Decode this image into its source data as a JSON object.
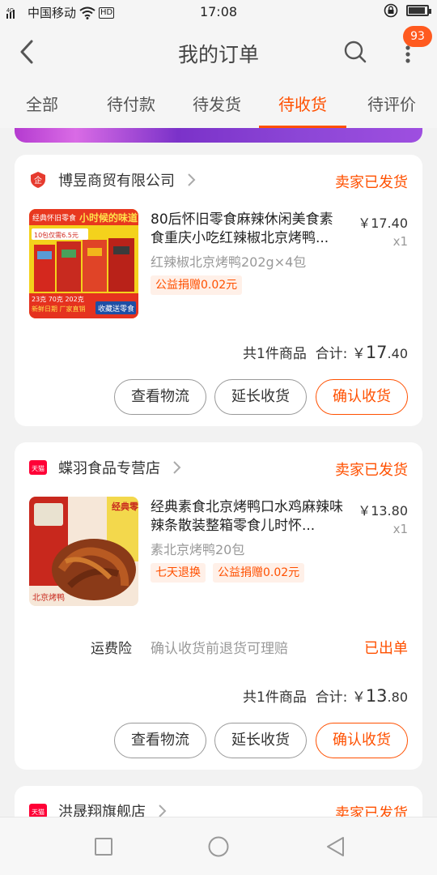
{
  "status_bar": {
    "carrier": "中国移动",
    "network": "4G",
    "volte": "HD",
    "time": "17:08",
    "battery_percent": 90
  },
  "header": {
    "title": "我的订单",
    "back_icon": "back-arrow-icon",
    "search_icon": "search-icon",
    "more_icon": "more-vertical-icon",
    "badge_count": "93"
  },
  "tabs": [
    {
      "label": "全部",
      "active": false
    },
    {
      "label": "待付款",
      "active": false
    },
    {
      "label": "待发货",
      "active": false
    },
    {
      "label": "待收货",
      "active": true
    },
    {
      "label": "待评价",
      "active": false
    }
  ],
  "orders": [
    {
      "shop_name": "博昱商贸有限公司",
      "shop_logo": "enterprise-shop-icon",
      "status": "卖家已发货",
      "product_title": "80后怀旧零食麻辣休闲美食素食重庆小吃红辣椒北京烤鸭...",
      "sku": "红辣椒北京烤鸭202g×4包",
      "price": "￥17.40",
      "qty": "x1",
      "tags": [
        "公益捐赠0.02元"
      ],
      "thumb_text": {
        "top_left": "经典怀旧零食",
        "top_right": "小时候的味道",
        "pack": "10包仅需6.5元",
        "bottom1": "23克  70克  202克",
        "bottom2": "新鲜日期 厂家直销",
        "bottom3": "收藏送零食"
      },
      "total_label": "共1件商品",
      "sum_label": "合计:",
      "total_currency": "￥",
      "total_int": "17",
      "total_dec": ".40",
      "buttons": [
        "查看物流",
        "延长收货",
        "确认收货"
      ]
    },
    {
      "shop_name": "蝶羽食品专营店",
      "shop_logo": "tmall-icon",
      "logo_text": "天猫",
      "status": "卖家已发货",
      "product_title": "经典素食北京烤鸭口水鸡麻辣味辣条散装整箱零食儿时怀...",
      "sku": "素北京烤鸭20包",
      "price": "￥13.80",
      "qty": "x1",
      "tags": [
        "七天退换",
        "公益捐赠0.02元"
      ],
      "thumb_text": {
        "side": "经典零食",
        "bottom": "北京烤鸭"
      },
      "insurance_label": "运费险",
      "insurance_text": "确认收货前退货可理赔",
      "insurance_status": "已出单",
      "total_label": "共1件商品",
      "sum_label": "合计:",
      "total_currency": "￥",
      "total_int": "13",
      "total_dec": ".80",
      "buttons": [
        "查看物流",
        "延长收货",
        "确认收货"
      ]
    },
    {
      "shop_name": "洪晟翔旗舰店",
      "shop_logo": "tmall-icon",
      "logo_text": "天猫",
      "status": "卖家已发货"
    }
  ],
  "nav_bar": {
    "recent_icon": "recent-apps-square-icon",
    "home_icon": "home-circle-icon",
    "back_icon": "back-triangle-icon"
  },
  "colors": {
    "accent": "#ff5000",
    "badge": "#ff5a1f",
    "background": "#f2f2f2"
  }
}
